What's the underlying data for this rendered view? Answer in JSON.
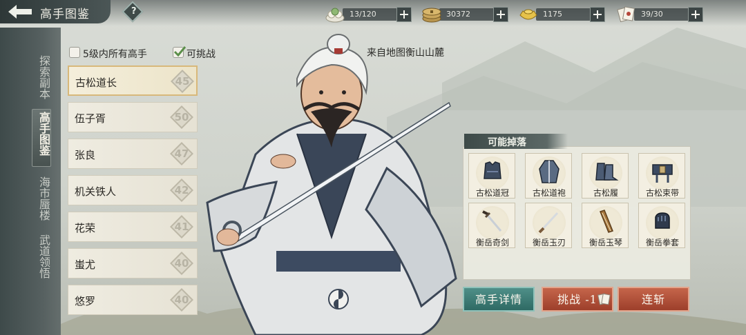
{
  "header": {
    "title": "高手图鉴",
    "help_label": "?"
  },
  "resources": [
    {
      "icon": "dumpling-icon",
      "value": "13/120"
    },
    {
      "icon": "coins-icon",
      "value": "30372"
    },
    {
      "icon": "gold-ingot-icon",
      "value": "1175"
    },
    {
      "icon": "ticket-cards-icon",
      "value": "39/30"
    }
  ],
  "left_nav": {
    "items": [
      {
        "label": "探索副本"
      },
      {
        "label": "高手图鉴"
      },
      {
        "label": "海市蜃楼"
      },
      {
        "label": "武道领悟"
      }
    ]
  },
  "filters": {
    "within_level_label": "5级内所有高手",
    "within_level_checked": false,
    "challengeable_label": "可挑战",
    "challengeable_checked": true
  },
  "masters": [
    {
      "name": "古松道长",
      "level": "45",
      "selected": true
    },
    {
      "name": "伍子胥",
      "level": "50"
    },
    {
      "name": "张良",
      "level": "47"
    },
    {
      "name": "机关铁人",
      "level": "42"
    },
    {
      "name": "花荣",
      "level": "41"
    },
    {
      "name": "蚩尤",
      "level": "40"
    },
    {
      "name": "悠罗",
      "level": "40"
    }
  ],
  "source_text": "来自地图衡山山麓",
  "drops": {
    "title": "可能掉落",
    "items": [
      {
        "name": "古松道冠",
        "icon": "vest-armor-icon"
      },
      {
        "name": "古松道袍",
        "icon": "robe-icon"
      },
      {
        "name": "古松履",
        "icon": "boots-icon"
      },
      {
        "name": "古松束带",
        "icon": "belt-icon"
      },
      {
        "name": "衡岳奇剑",
        "icon": "sword-icon"
      },
      {
        "name": "衡岳玉刃",
        "icon": "blade-icon"
      },
      {
        "name": "衡岳玉琴",
        "icon": "qin-instrument-icon"
      },
      {
        "name": "衡岳拳套",
        "icon": "gauntlet-icon"
      }
    ]
  },
  "buttons": {
    "details": "高手详情",
    "challenge": "挑战 -1",
    "sweep": "连斩"
  },
  "colors": {
    "teal_button": "#2f6a64",
    "red_button": "#9d3f2b",
    "selected_border": "#d8b87a"
  }
}
